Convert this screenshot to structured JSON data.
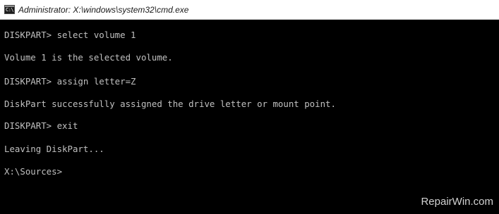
{
  "window": {
    "title": "Administrator: X:\\windows\\system32\\cmd.exe",
    "icon": "cmd-console-icon",
    "icon_text": "C:\\"
  },
  "console": {
    "lines": [
      "DISKPART> select volume 1",
      "Volume 1 is the selected volume.",
      "DISKPART> assign letter=Z",
      "DiskPart successfully assigned the drive letter or mount point.",
      "DISKPART> exit",
      "Leaving DiskPart...",
      "X:\\Sources>"
    ]
  },
  "watermark": {
    "text": "RepairWin.com"
  },
  "colors": {
    "background": "#000000",
    "text": "#c0c0c0",
    "titlebar": "#ffffff"
  }
}
